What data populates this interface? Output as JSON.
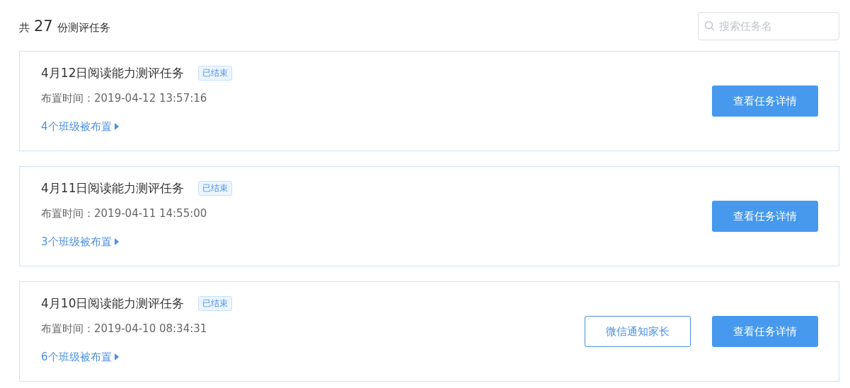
{
  "summary": {
    "prefix": "共",
    "count": "27",
    "suffix": "份测评任务"
  },
  "search": {
    "placeholder": "搜索任务名"
  },
  "tasks": [
    {
      "title": "4月12日阅读能力测评任务",
      "status": "已结束",
      "assigned_time": "布置时间：2019-04-12 13:57:16",
      "classes_link": "4个班级被布置",
      "buttons": [
        {
          "label": "查看任务详情",
          "kind": "primary"
        }
      ]
    },
    {
      "title": "4月11日阅读能力测评任务",
      "status": "已结束",
      "assigned_time": "布置时间：2019-04-11 14:55:00",
      "classes_link": "3个班级被布置",
      "buttons": [
        {
          "label": "查看任务详情",
          "kind": "primary"
        }
      ]
    },
    {
      "title": "4月10日阅读能力测评任务",
      "status": "已结束",
      "assigned_time": "布置时间：2019-04-10 08:34:31",
      "classes_link": "6个班级被布置",
      "buttons": [
        {
          "label": "微信通知家长",
          "kind": "outline"
        },
        {
          "label": "查看任务详情",
          "kind": "primary"
        }
      ]
    }
  ]
}
